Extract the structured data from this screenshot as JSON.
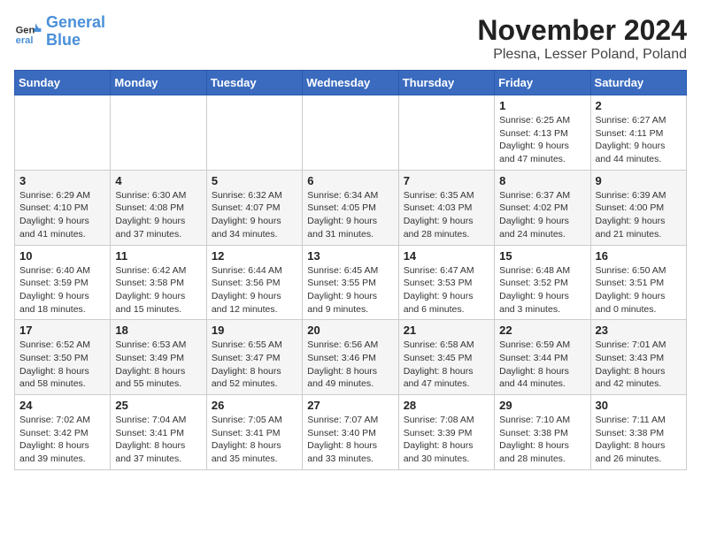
{
  "logo": {
    "line1": "General",
    "line2": "Blue"
  },
  "title": "November 2024",
  "subtitle": "Plesna, Lesser Poland, Poland",
  "days_of_week": [
    "Sunday",
    "Monday",
    "Tuesday",
    "Wednesday",
    "Thursday",
    "Friday",
    "Saturday"
  ],
  "weeks": [
    [
      {
        "day": "",
        "info": ""
      },
      {
        "day": "",
        "info": ""
      },
      {
        "day": "",
        "info": ""
      },
      {
        "day": "",
        "info": ""
      },
      {
        "day": "",
        "info": ""
      },
      {
        "day": "1",
        "info": "Sunrise: 6:25 AM\nSunset: 4:13 PM\nDaylight: 9 hours and 47 minutes."
      },
      {
        "day": "2",
        "info": "Sunrise: 6:27 AM\nSunset: 4:11 PM\nDaylight: 9 hours and 44 minutes."
      }
    ],
    [
      {
        "day": "3",
        "info": "Sunrise: 6:29 AM\nSunset: 4:10 PM\nDaylight: 9 hours and 41 minutes."
      },
      {
        "day": "4",
        "info": "Sunrise: 6:30 AM\nSunset: 4:08 PM\nDaylight: 9 hours and 37 minutes."
      },
      {
        "day": "5",
        "info": "Sunrise: 6:32 AM\nSunset: 4:07 PM\nDaylight: 9 hours and 34 minutes."
      },
      {
        "day": "6",
        "info": "Sunrise: 6:34 AM\nSunset: 4:05 PM\nDaylight: 9 hours and 31 minutes."
      },
      {
        "day": "7",
        "info": "Sunrise: 6:35 AM\nSunset: 4:03 PM\nDaylight: 9 hours and 28 minutes."
      },
      {
        "day": "8",
        "info": "Sunrise: 6:37 AM\nSunset: 4:02 PM\nDaylight: 9 hours and 24 minutes."
      },
      {
        "day": "9",
        "info": "Sunrise: 6:39 AM\nSunset: 4:00 PM\nDaylight: 9 hours and 21 minutes."
      }
    ],
    [
      {
        "day": "10",
        "info": "Sunrise: 6:40 AM\nSunset: 3:59 PM\nDaylight: 9 hours and 18 minutes."
      },
      {
        "day": "11",
        "info": "Sunrise: 6:42 AM\nSunset: 3:58 PM\nDaylight: 9 hours and 15 minutes."
      },
      {
        "day": "12",
        "info": "Sunrise: 6:44 AM\nSunset: 3:56 PM\nDaylight: 9 hours and 12 minutes."
      },
      {
        "day": "13",
        "info": "Sunrise: 6:45 AM\nSunset: 3:55 PM\nDaylight: 9 hours and 9 minutes."
      },
      {
        "day": "14",
        "info": "Sunrise: 6:47 AM\nSunset: 3:53 PM\nDaylight: 9 hours and 6 minutes."
      },
      {
        "day": "15",
        "info": "Sunrise: 6:48 AM\nSunset: 3:52 PM\nDaylight: 9 hours and 3 minutes."
      },
      {
        "day": "16",
        "info": "Sunrise: 6:50 AM\nSunset: 3:51 PM\nDaylight: 9 hours and 0 minutes."
      }
    ],
    [
      {
        "day": "17",
        "info": "Sunrise: 6:52 AM\nSunset: 3:50 PM\nDaylight: 8 hours and 58 minutes."
      },
      {
        "day": "18",
        "info": "Sunrise: 6:53 AM\nSunset: 3:49 PM\nDaylight: 8 hours and 55 minutes."
      },
      {
        "day": "19",
        "info": "Sunrise: 6:55 AM\nSunset: 3:47 PM\nDaylight: 8 hours and 52 minutes."
      },
      {
        "day": "20",
        "info": "Sunrise: 6:56 AM\nSunset: 3:46 PM\nDaylight: 8 hours and 49 minutes."
      },
      {
        "day": "21",
        "info": "Sunrise: 6:58 AM\nSunset: 3:45 PM\nDaylight: 8 hours and 47 minutes."
      },
      {
        "day": "22",
        "info": "Sunrise: 6:59 AM\nSunset: 3:44 PM\nDaylight: 8 hours and 44 minutes."
      },
      {
        "day": "23",
        "info": "Sunrise: 7:01 AM\nSunset: 3:43 PM\nDaylight: 8 hours and 42 minutes."
      }
    ],
    [
      {
        "day": "24",
        "info": "Sunrise: 7:02 AM\nSunset: 3:42 PM\nDaylight: 8 hours and 39 minutes."
      },
      {
        "day": "25",
        "info": "Sunrise: 7:04 AM\nSunset: 3:41 PM\nDaylight: 8 hours and 37 minutes."
      },
      {
        "day": "26",
        "info": "Sunrise: 7:05 AM\nSunset: 3:41 PM\nDaylight: 8 hours and 35 minutes."
      },
      {
        "day": "27",
        "info": "Sunrise: 7:07 AM\nSunset: 3:40 PM\nDaylight: 8 hours and 33 minutes."
      },
      {
        "day": "28",
        "info": "Sunrise: 7:08 AM\nSunset: 3:39 PM\nDaylight: 8 hours and 30 minutes."
      },
      {
        "day": "29",
        "info": "Sunrise: 7:10 AM\nSunset: 3:38 PM\nDaylight: 8 hours and 28 minutes."
      },
      {
        "day": "30",
        "info": "Sunrise: 7:11 AM\nSunset: 3:38 PM\nDaylight: 8 hours and 26 minutes."
      }
    ]
  ]
}
